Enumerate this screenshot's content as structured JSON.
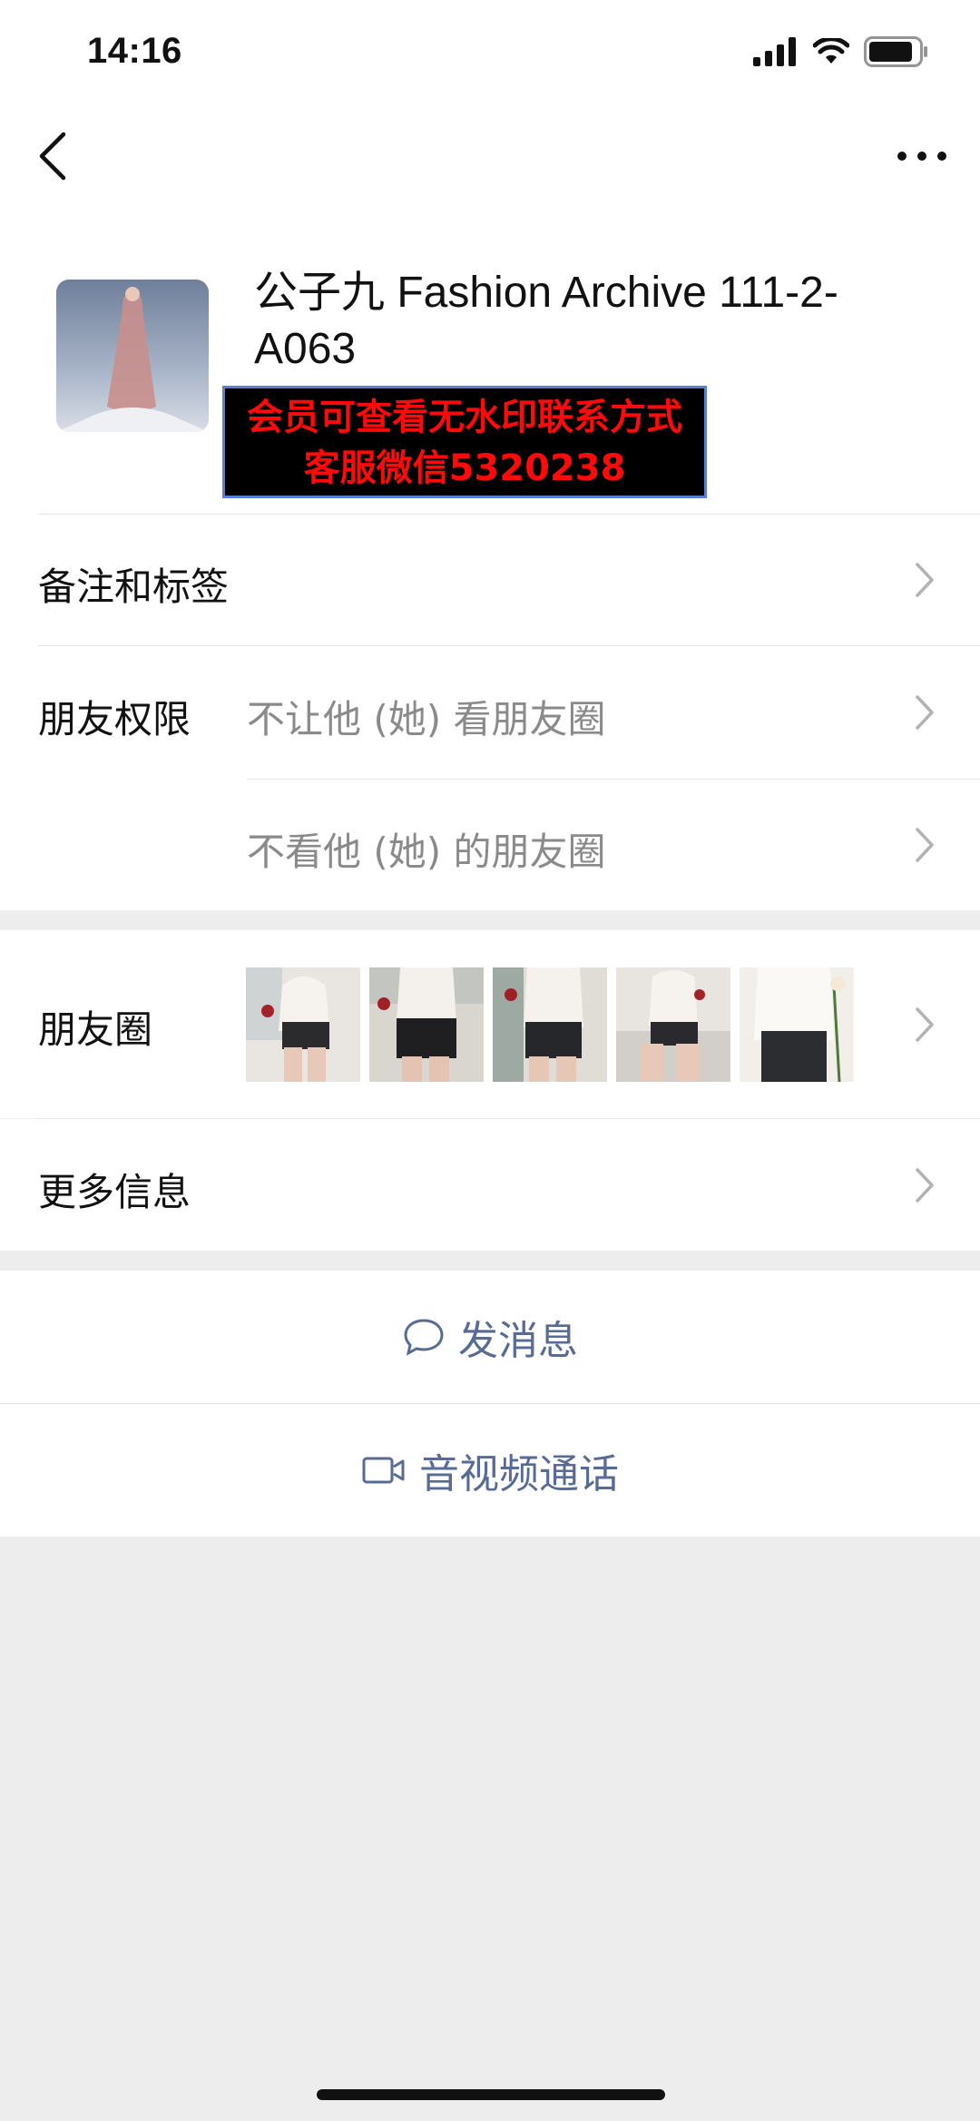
{
  "status_bar": {
    "time": "14:16"
  },
  "profile": {
    "name": "公子九 Fashion Archive 111-2-A063",
    "banner_line1": "会员可查看无水印联系方式",
    "banner_line2": "客服微信5320238"
  },
  "rows": {
    "remarks_tags": "备注和标签",
    "friend_permissions": "朋友权限",
    "hide_my_moments": "不让他 (她) 看朋友圈",
    "hide_their_moments": "不看他 (她) 的朋友圈",
    "moments": "朋友圈",
    "more_info": "更多信息"
  },
  "actions": {
    "send_message": "发消息",
    "video_call": "音视频通话"
  },
  "colors": {
    "link_blue": "#576b95",
    "banner_red": "#ff0a0a",
    "page_gray": "#ededed"
  }
}
